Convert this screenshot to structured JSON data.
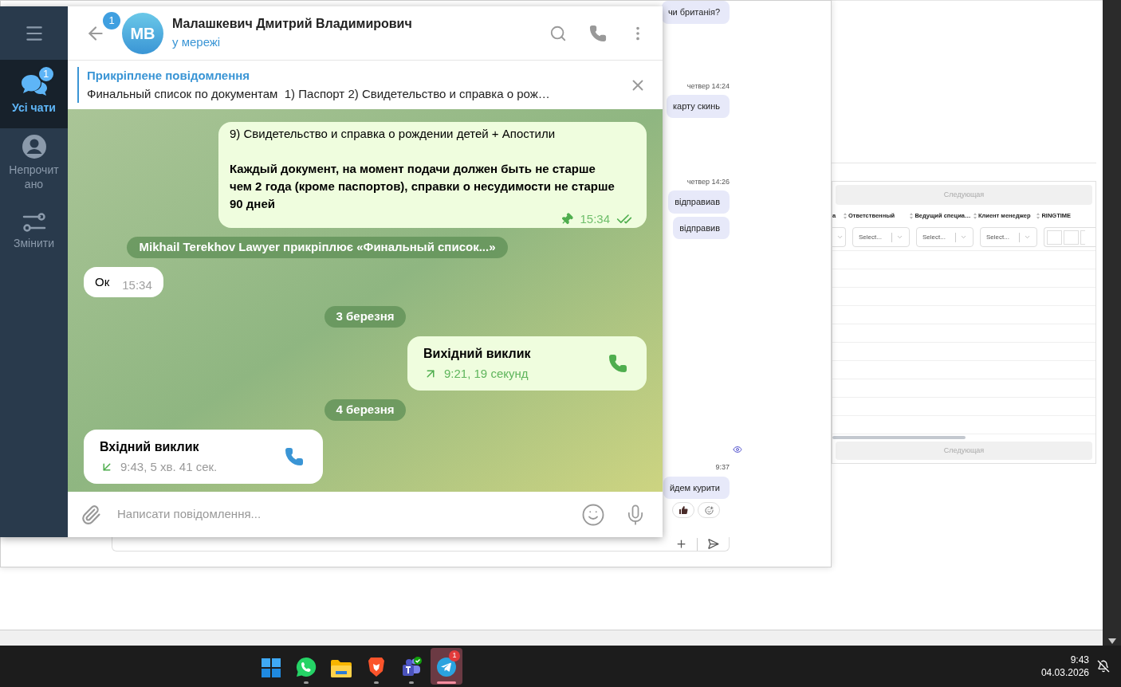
{
  "telegram": {
    "sidebar": {
      "items": [
        {
          "kind": "chats",
          "label": "Усі чати",
          "selected": true,
          "badge": "1"
        },
        {
          "kind": "unread",
          "label": "Непрочитано",
          "selected": false
        },
        {
          "kind": "edit",
          "label": "Змінити",
          "selected": false
        }
      ]
    },
    "header": {
      "back_badge": "1",
      "avatar_initials": "MB",
      "name": "Малашкевич Дмитрий Владимирович",
      "status": "у мережі"
    },
    "pinned": {
      "title": "Прикріплене повідомлення",
      "text": "Финальный список по документам  1) Паспорт 2) Свидетельство и справка о рож…"
    },
    "messages": [
      {
        "kind": "text",
        "outgoing": true,
        "paragraphs": [
          {
            "text": "9) Свидетельство и справка о рождении детей + Апостили",
            "bold": false
          },
          {
            "text": "Каждый документ, на момент подачи должен быть не старше чем 2 года (кроме паспортов), справки о несудимости не старше 90 дней",
            "bold": true
          }
        ],
        "pinned": true,
        "time": "15:34",
        "read": true
      },
      {
        "kind": "service",
        "text": "Mikhail Terekhov Lawyer прикріплює «Финальный список...»"
      },
      {
        "kind": "text",
        "outgoing": false,
        "paragraphs": [
          {
            "text": "Ок",
            "bold": false
          }
        ],
        "pinned": false,
        "time": "15:34",
        "read": false
      },
      {
        "kind": "date",
        "text": "3 березня"
      },
      {
        "kind": "call",
        "outgoing": true,
        "title": "Вихідний виклик",
        "detail": "9:21, 19 секунд"
      },
      {
        "kind": "date",
        "text": "4 березня"
      },
      {
        "kind": "call",
        "outgoing": false,
        "title": "Вхідний виклик",
        "detail": "9:43, 5 хв. 41 сек."
      }
    ],
    "composer": {
      "placeholder": "Написати повідомлення..."
    }
  },
  "background_chat": {
    "groups": [
      [
        {
          "kind": "bubble",
          "text": "чи британія?"
        }
      ],
      [
        {
          "kind": "time",
          "text": "четвер 14:24"
        },
        {
          "kind": "bubble",
          "text": "карту скинь"
        }
      ],
      [
        {
          "kind": "time",
          "text": "четвер 14:26"
        },
        {
          "kind": "bubble",
          "text": "відправиав"
        },
        {
          "kind": "bubble",
          "text": "відправив"
        }
      ],
      [
        {
          "kind": "time",
          "text": "9:37"
        },
        {
          "kind": "bubble",
          "text": "йдем курити"
        },
        {
          "kind": "reactions"
        }
      ]
    ]
  },
  "table": {
    "pager": [
      "Следующая",
      "Следующая"
    ],
    "columns": [
      "а",
      "Ответственный",
      "Ведущий специа…",
      "Клиент менеджер",
      "RINGTIME"
    ],
    "filters": [
      "Select...",
      "Select...",
      "Select..."
    ]
  },
  "taskbar": {
    "apps": [
      {
        "kind": "start",
        "running": false,
        "selected": false
      },
      {
        "kind": "whatsapp",
        "running": true,
        "selected": false
      },
      {
        "kind": "files",
        "running": false,
        "selected": false
      },
      {
        "kind": "browser",
        "running": true,
        "selected": false
      },
      {
        "kind": "teams",
        "running": true,
        "selected": false
      },
      {
        "kind": "telegram",
        "running": true,
        "selected": true,
        "badge": "1"
      }
    ],
    "time": "9:43",
    "date": "04.03.2026"
  }
}
